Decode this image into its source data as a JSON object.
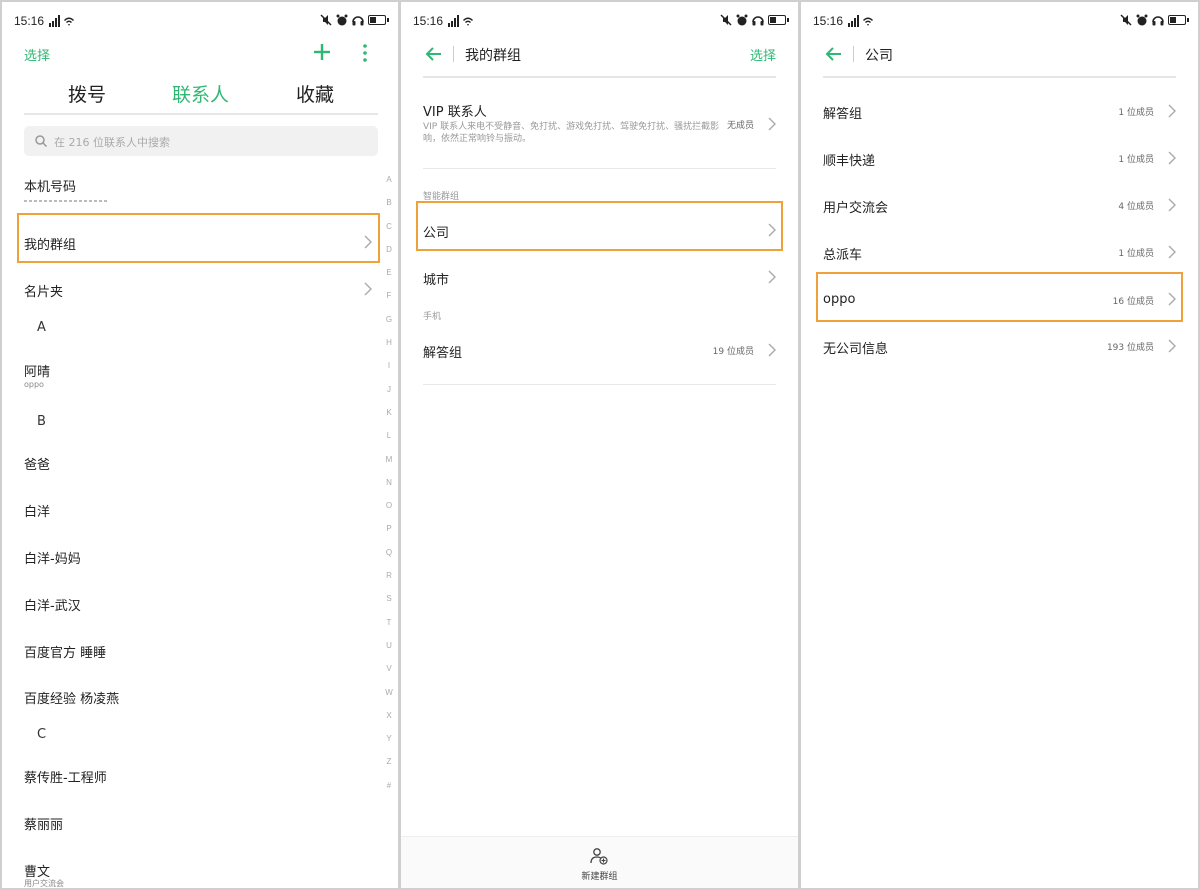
{
  "status": {
    "time": "15:16"
  },
  "accent": "#2fb873",
  "highlight": "#f0a23a",
  "contacts": {
    "select_label": "选择",
    "tabs": [
      "拨号",
      "联系人",
      "收藏"
    ],
    "search_placeholder": "在 216 位联系人中搜索",
    "rows": {
      "my_number": "本机号码",
      "my_groups": "我的群组",
      "cards": "名片夹",
      "letter_a": "A",
      "aqing": "阿晴",
      "aqing_sub": "oppo",
      "letter_b": "B",
      "baba": "爸爸",
      "baiyang": "白洋",
      "baiyang_mama": "白洋-妈妈",
      "baiyang_wuhan": "白洋-武汉",
      "baidu_guanfang": "百度官方 睡睡",
      "baidu_jingyan": "百度经验 杨凌燕",
      "letter_c": "C",
      "cai_engineer": "蔡传胜-工程师",
      "cai_li": "蔡丽丽",
      "cao_wen": "曹文",
      "cao_wen_sub": "用户交流会"
    },
    "alphabet": [
      "A",
      "B",
      "C",
      "D",
      "E",
      "F",
      "G",
      "H",
      "I",
      "J",
      "K",
      "L",
      "M",
      "N",
      "O",
      "P",
      "Q",
      "R",
      "S",
      "T",
      "U",
      "V",
      "W",
      "X",
      "Y",
      "Z",
      "#"
    ]
  },
  "groups": {
    "title": "我的群组",
    "select_label": "选择",
    "vip_title": "VIP 联系人",
    "vip_desc": "VIP 联系人来电不受静音、免打扰、游戏免打扰、驾驶免打扰、骚扰拦截影响，依然正常响铃与振动。",
    "vip_count": "无成员",
    "smart_section": "智能群组",
    "company": "公司",
    "city": "城市",
    "manual_section": "手机",
    "answer_group": "解答组",
    "answer_count": "19 位成员",
    "new_group": "新建群组"
  },
  "company": {
    "title": "公司",
    "items": [
      {
        "name": "解答组",
        "count": "1 位成员"
      },
      {
        "name": "顺丰快递",
        "count": "1 位成员"
      },
      {
        "name": "用户交流会",
        "count": "4 位成员"
      },
      {
        "name": "总派车",
        "count": "1 位成员"
      },
      {
        "name": "oppo",
        "count": "16 位成员"
      },
      {
        "name": "无公司信息",
        "count": "193 位成员"
      }
    ]
  }
}
